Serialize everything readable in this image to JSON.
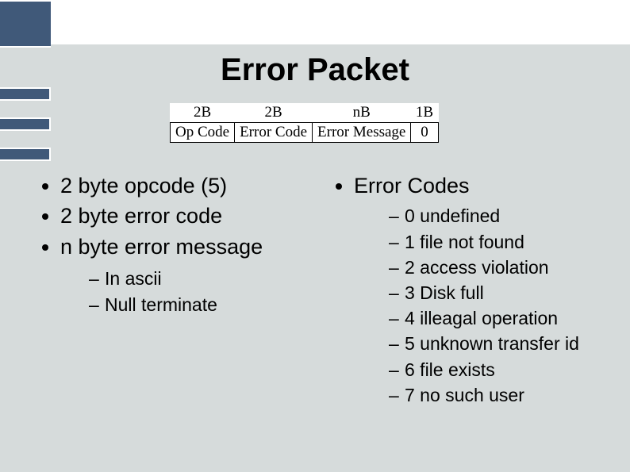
{
  "title": "Error Packet",
  "packet": {
    "sizes": [
      "2B",
      "2B",
      "nB",
      "1B"
    ],
    "fields": [
      "Op Code",
      "Error Code",
      "Error Message",
      "0"
    ]
  },
  "left": {
    "items": [
      "2 byte opcode (5)",
      "2 byte error code",
      "n byte error message"
    ],
    "sub": [
      "In ascii",
      "Null terminate"
    ]
  },
  "right": {
    "heading": "Error Codes",
    "codes": [
      "0 undefined",
      "1 file not found",
      "2 access violation",
      "3 Disk full",
      "4 illeagal operation",
      "5 unknown transfer id",
      "6 file exists",
      "7 no such user"
    ]
  }
}
